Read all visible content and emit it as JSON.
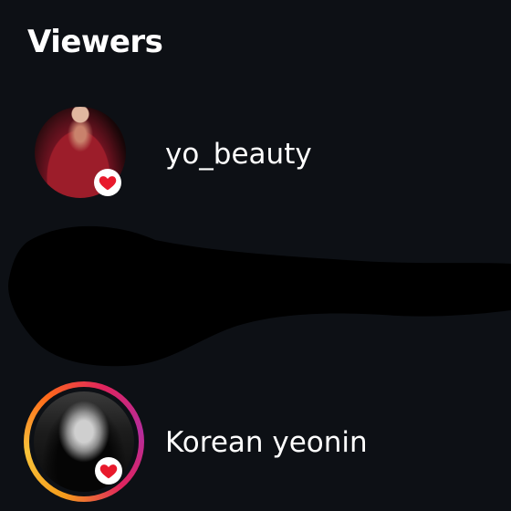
{
  "header": {
    "title": "Viewers"
  },
  "viewers": [
    {
      "username": "yo_beauty",
      "liked": true,
      "story_ring": false
    },
    {
      "username": "Korean yeonin",
      "liked": true,
      "story_ring": true
    }
  ],
  "colors": {
    "background": "#0d1015",
    "text": "#ffffff",
    "heart": "#e8192c",
    "ring_gradient": [
      "#f59c1c",
      "#f8c33a",
      "#ff6a1a",
      "#e0245e",
      "#b52c9b"
    ]
  },
  "icons": {
    "liked_badge": "heart-icon"
  }
}
